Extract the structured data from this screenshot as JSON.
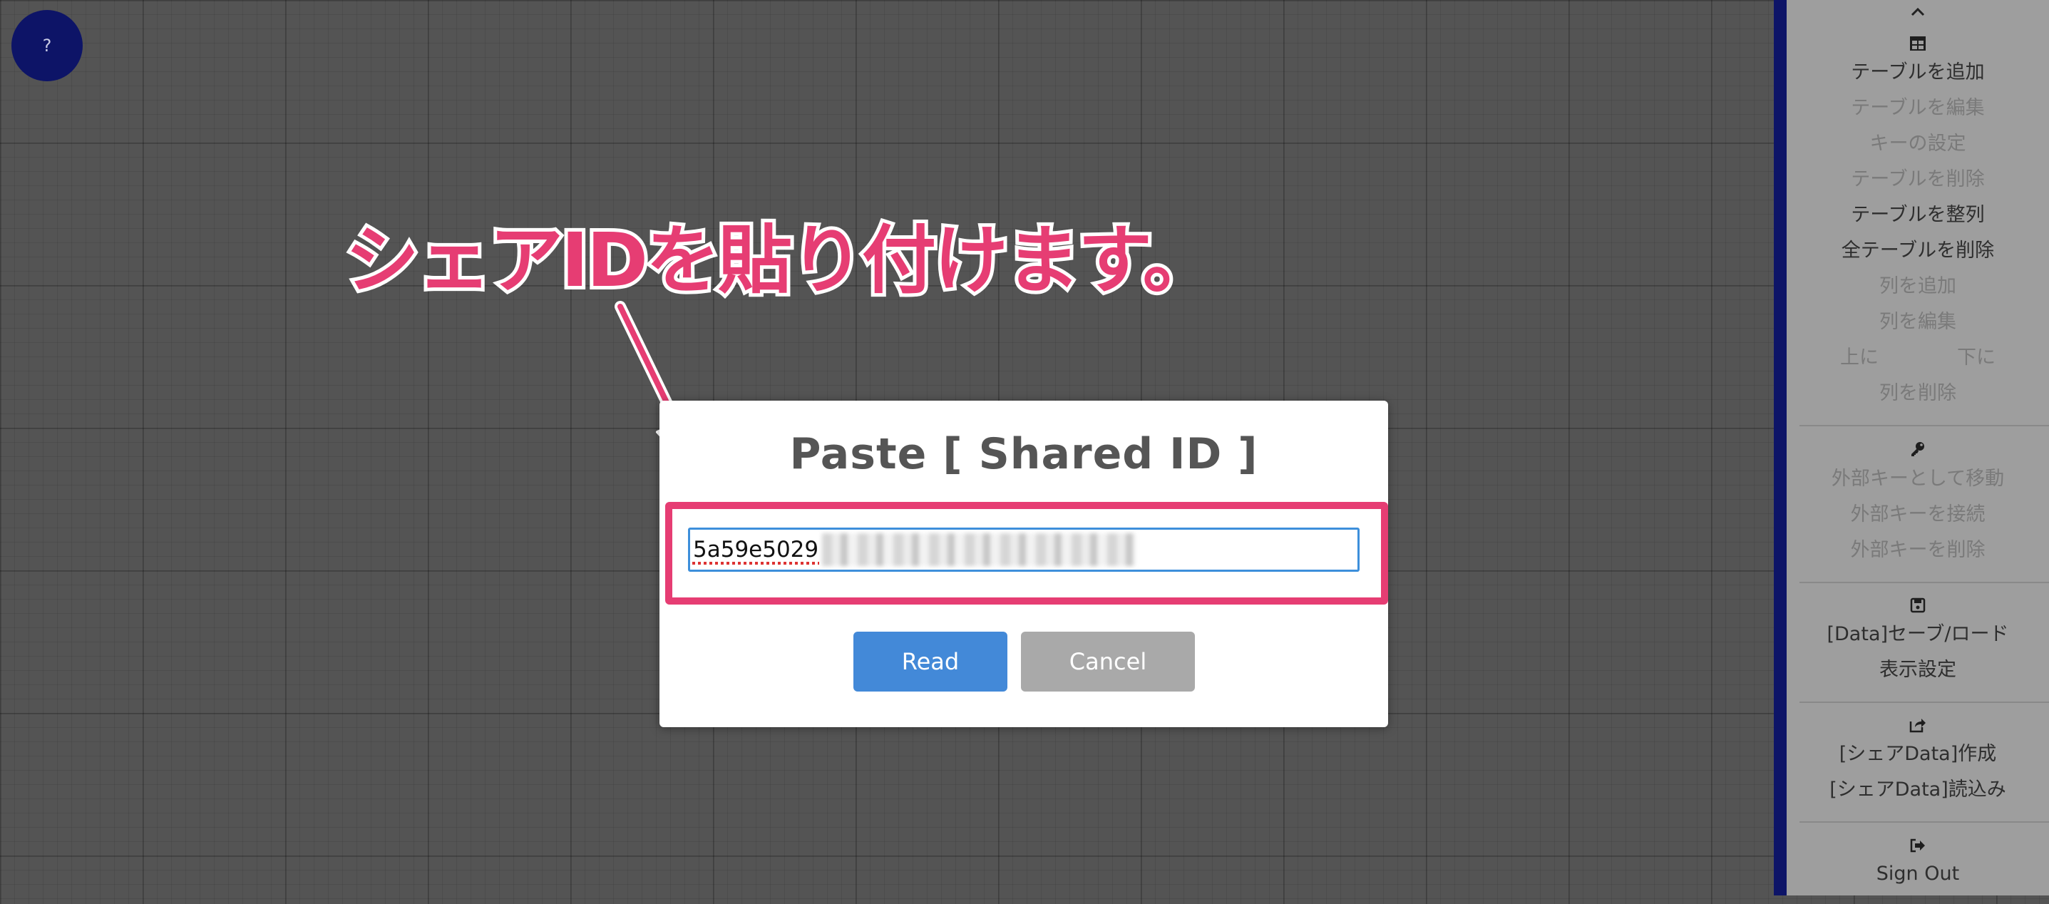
{
  "help_button": {
    "label": "?"
  },
  "sidebar": {
    "collapse_icon": "chevron-up-icon",
    "table_section": {
      "icon": "table-icon",
      "items": [
        {
          "label": "テーブルを追加",
          "enabled": true
        },
        {
          "label": "テーブルを編集",
          "enabled": false
        },
        {
          "label": "キーの設定",
          "enabled": false
        },
        {
          "label": "テーブルを削除",
          "enabled": false
        },
        {
          "label": "テーブルを整列",
          "enabled": true
        },
        {
          "label": "全テーブルを削除",
          "enabled": true
        },
        {
          "label": "列を追加",
          "enabled": false
        },
        {
          "label": "列を編集",
          "enabled": false
        }
      ],
      "move_up": "上に",
      "move_down": "下に",
      "delete_column": "列を削除"
    },
    "key_section": {
      "icon": "key-icon",
      "items": [
        {
          "label": "外部キーとして移動",
          "enabled": false
        },
        {
          "label": "外部キーを接続",
          "enabled": false
        },
        {
          "label": "外部キーを削除",
          "enabled": false
        }
      ]
    },
    "data_section": {
      "icon": "save-icon",
      "items": [
        {
          "label": "[Data]セーブ/ロード",
          "enabled": true
        },
        {
          "label": "表示設定",
          "enabled": true
        }
      ]
    },
    "share_section": {
      "icon": "share-icon",
      "items": [
        {
          "label": "[シェアData]作成",
          "enabled": true
        },
        {
          "label": "[シェアData]読込み",
          "enabled": true
        }
      ]
    },
    "signout_section": {
      "icon": "sign-out-icon",
      "label": "Sign Out"
    }
  },
  "annotation": {
    "text": "シェアIDを貼り付けます。",
    "color": "#e63d73"
  },
  "modal": {
    "title": "Paste [ Shared ID ]",
    "input_value": "5a59e5029",
    "read_label": "Read",
    "cancel_label": "Cancel",
    "read_color": "#4389d8",
    "cancel_color": "#a9a9a9"
  }
}
